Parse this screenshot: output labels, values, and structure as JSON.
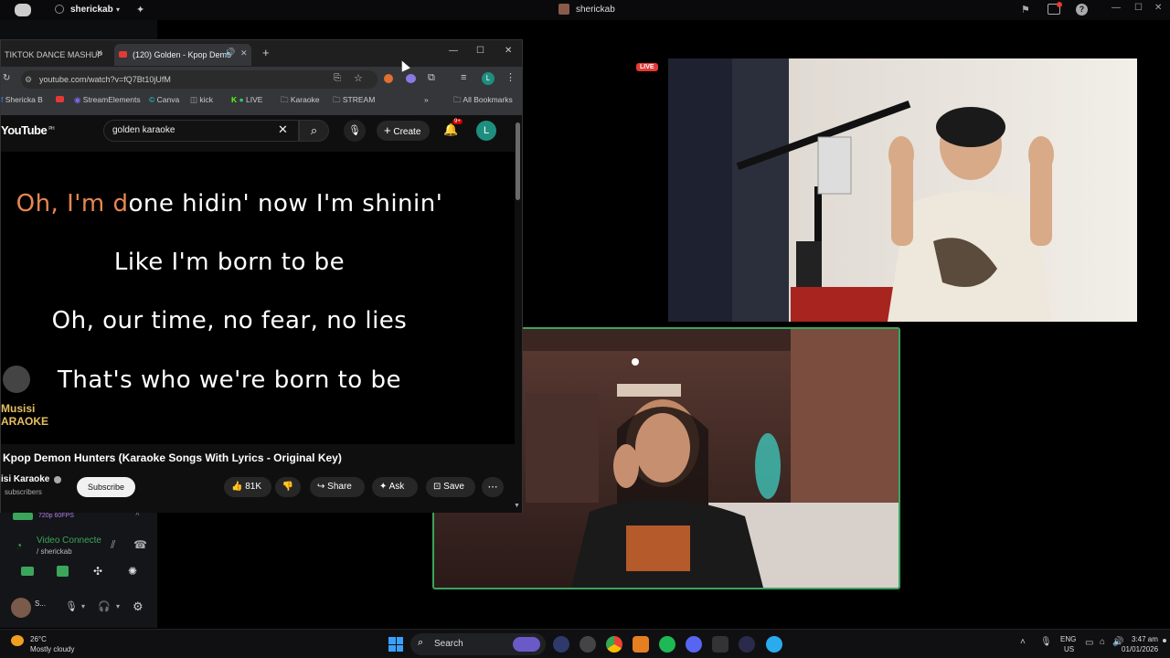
{
  "discord": {
    "username": "sherickab",
    "stream_title": "sherickab",
    "live_badge": "LIVE",
    "voice": {
      "quality": "720p 60FPS",
      "status": "Video Connecte",
      "channel": "/ sherickab",
      "user_short": "S..."
    }
  },
  "chrome": {
    "tabs": [
      {
        "label": "TIKTOK DANCE MASHUP"
      },
      {
        "label": "(120) Golden - Kpop Demo"
      }
    ],
    "url": "youtube.com/watch?v=fQ7Bt10jUfM",
    "avatar_letter": "L",
    "bookmarks": [
      "Shericka B",
      "StreamElements",
      "Canva",
      "kick",
      "LIVE",
      "Karaoke",
      "STREAM"
    ],
    "all_bookmarks": "All Bookmarks"
  },
  "youtube": {
    "logo": "YouTube",
    "region": "PH",
    "search_value": "golden karaoke",
    "create_label": "Create",
    "notif_count": "9+",
    "avatar_letter": "L",
    "lyrics": {
      "line1_highlight": "Oh, I'm d",
      "line1_rest": "one hidin' now I'm shinin'",
      "line2": "Like I'm born to be",
      "line3": "Oh, our time, no fear, no lies",
      "line4": "That's who we're born to be"
    },
    "watermark_top": "Musisi",
    "watermark_bottom": "ARAOKE",
    "video_title": "Kpop Demon Hunters (Karaoke Songs With Lyrics - Original Key)",
    "channel_name": "isi Karaoke",
    "subscribers": "subscribers",
    "subscribe_label": "Subscribe",
    "likes": "81K",
    "share_label": "Share",
    "ask_label": "Ask",
    "save_label": "Save"
  },
  "taskbar": {
    "weather_temp": "26°C",
    "weather_desc": "Mostly cloudy",
    "search_label": "Search",
    "lang_top": "ENG",
    "lang_bottom": "US",
    "time": "3:47 am",
    "date": "01/01/2026"
  },
  "colors": {
    "accent_green": "#3ba55c",
    "live_red": "#e53935",
    "lyric_orange": "#e8864f"
  }
}
